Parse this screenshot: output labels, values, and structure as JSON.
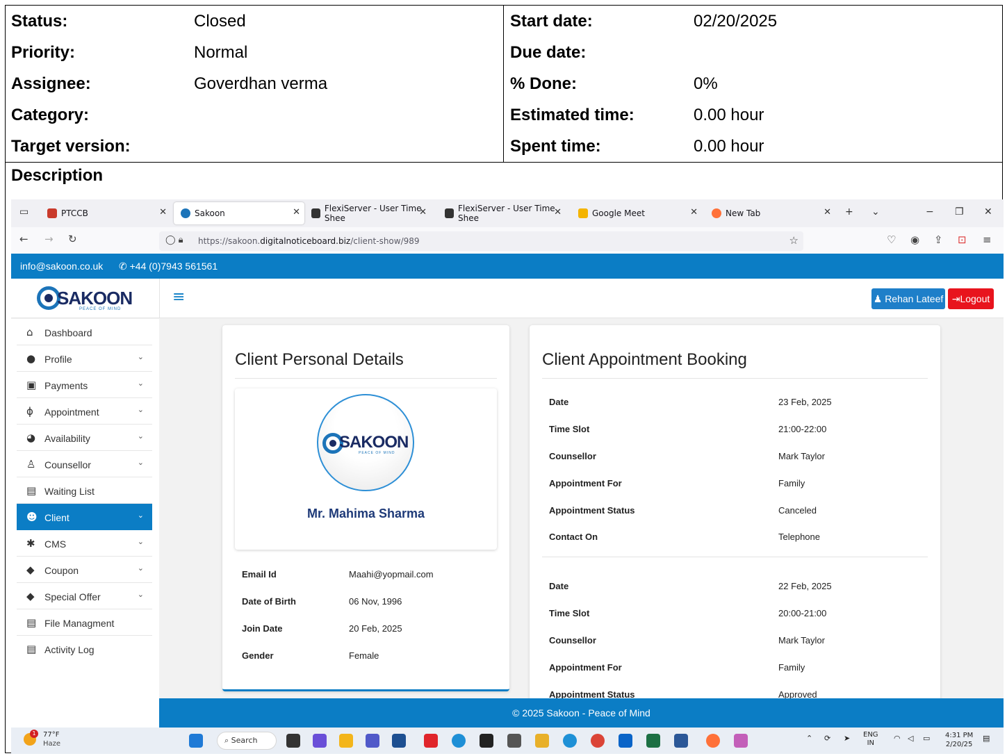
{
  "issue": {
    "left_attrs": [
      {
        "key": "Status:",
        "value": "Closed"
      },
      {
        "key": "Priority:",
        "value": "Normal"
      },
      {
        "key": "Assignee:",
        "value": "Goverdhan verma"
      },
      {
        "key": "Category:",
        "value": ""
      },
      {
        "key": "Target version:",
        "value": ""
      }
    ],
    "right_attrs": [
      {
        "key": "Start date:",
        "value": "02/20/2025"
      },
      {
        "key": "Due date:",
        "value": ""
      },
      {
        "key": "% Done:",
        "value": "0%"
      },
      {
        "key": "Estimated time:",
        "value": "0.00 hour"
      },
      {
        "key": "Spent time:",
        "value": "0.00 hour"
      }
    ],
    "description_label": "Description"
  },
  "browser": {
    "tabs": [
      {
        "label": "PTCCB",
        "fav_color": "#c93a2b"
      },
      {
        "label": "Sakoon",
        "fav_color": "#1c74b9"
      },
      {
        "label": "FlexiServer - User Time Shee",
        "fav_color": "#333333"
      },
      {
        "label": "FlexiServer - User Time Shee",
        "fav_color": "#333333"
      },
      {
        "label": "Google Meet",
        "fav_color": "#f4b400"
      },
      {
        "label": "New Tab",
        "fav_color": "#ff7139"
      }
    ],
    "url_prefix": "https://sakoon.",
    "url_domain": "digitalnoticeboard.biz",
    "url_path": "/client-show/989"
  },
  "site": {
    "contact_email": "info@sakoon.co.uk",
    "contact_phone": "+44 (0)7943 561561",
    "logo_text": "SAKOON",
    "logo_tagline": "PEACE OF MIND",
    "user_button": "Rehan Lateef",
    "logout_button": "Logout",
    "footer": "© 2025 Sakoon - Peace of Mind",
    "sidebar": [
      {
        "label": "Dashboard",
        "icon": "home-icon",
        "glyph": "⌂",
        "chevron": false
      },
      {
        "label": "Profile",
        "icon": "user-circle-icon",
        "glyph": "●",
        "chevron": true
      },
      {
        "label": "Payments",
        "icon": "money-icon",
        "glyph": "▣",
        "chevron": true
      },
      {
        "label": "Appointment",
        "icon": "stethoscope-icon",
        "glyph": "ϕ",
        "chevron": true
      },
      {
        "label": "Availability",
        "icon": "gauge-icon",
        "glyph": "◕",
        "chevron": true
      },
      {
        "label": "Counsellor",
        "icon": "user-tie-icon",
        "glyph": "♙",
        "chevron": true
      },
      {
        "label": "Waiting List",
        "icon": "document-icon",
        "glyph": "▤",
        "chevron": false
      },
      {
        "label": "Client",
        "icon": "users-icon",
        "glyph": "☻",
        "chevron": true
      },
      {
        "label": "CMS",
        "icon": "gear-icon",
        "glyph": "✱",
        "chevron": true
      },
      {
        "label": "Coupon",
        "icon": "tag-icon",
        "glyph": "◆",
        "chevron": true
      },
      {
        "label": "Special Offer",
        "icon": "tags-icon",
        "glyph": "◆",
        "chevron": true
      },
      {
        "label": "File Managment",
        "icon": "document-icon",
        "glyph": "▤",
        "chevron": false
      },
      {
        "label": "Activity Log",
        "icon": "document-icon",
        "glyph": "▤",
        "chevron": false
      }
    ],
    "personal": {
      "title": "Client Personal Details",
      "name": "Mr. Mahima Sharma",
      "fields": [
        {
          "key": "Email Id",
          "value": "Maahi@yopmail.com"
        },
        {
          "key": "Date of Birth",
          "value": "06 Nov, 1996"
        },
        {
          "key": "Join Date",
          "value": "20 Feb, 2025"
        },
        {
          "key": "Gender",
          "value": "Female"
        }
      ]
    },
    "booking": {
      "title": "Client Appointment Booking",
      "appointments": [
        [
          {
            "key": "Date",
            "value": "23 Feb, 2025"
          },
          {
            "key": "Time Slot",
            "value": "21:00-22:00"
          },
          {
            "key": "Counsellor",
            "value": "Mark Taylor"
          },
          {
            "key": "Appointment For",
            "value": "Family"
          },
          {
            "key": "Appointment Status",
            "value": "Canceled"
          },
          {
            "key": "Contact On",
            "value": "Telephone"
          }
        ],
        [
          {
            "key": "Date",
            "value": "22 Feb, 2025"
          },
          {
            "key": "Time Slot",
            "value": "20:00-21:00"
          },
          {
            "key": "Counsellor",
            "value": "Mark Taylor"
          },
          {
            "key": "Appointment For",
            "value": "Family"
          },
          {
            "key": "Appointment Status",
            "value": "Approved"
          }
        ]
      ]
    }
  },
  "taskbar": {
    "weather_temp": "77°F",
    "weather_desc": "Haze",
    "weather_badge": "1",
    "search_label": "Search",
    "lang_top": "ENG",
    "lang_bottom": "IN",
    "time": "4:31 PM",
    "date": "2/20/25"
  }
}
